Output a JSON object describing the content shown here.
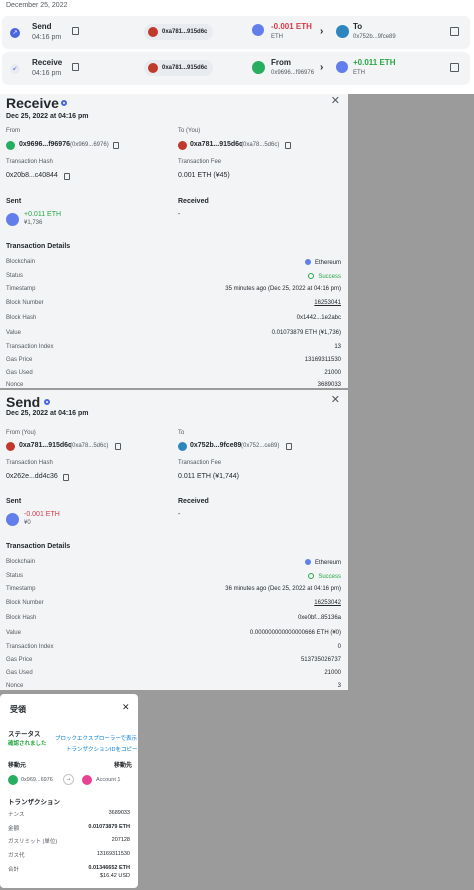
{
  "activity": {
    "date": "December 25, 2022",
    "rows": [
      {
        "type": "Send",
        "time": "04:16 pm",
        "chip": "0xa781...915d6c",
        "amount": "-0.001 ETH",
        "amount_sub": "ETH",
        "to_label": "To",
        "to_addr": "0x752b...9fce89",
        "amount_color": "#d73a49"
      },
      {
        "type": "Receive",
        "time": "04:16 pm",
        "chip": "0xa781...915d6c",
        "from_label": "From",
        "from_addr": "0x9696...f96976",
        "amount": "+0.011 ETH",
        "amount_sub": "ETH",
        "amount_color": "#28a745"
      }
    ]
  },
  "receive": {
    "title": "Receive",
    "date": "Dec 25, 2022 at 04:16 pm",
    "from_label": "From",
    "from_addr": "0x9696...f96976",
    "from_addr_paren": "(0x969...6976)",
    "to_label": "To (You)",
    "to_addr": "0xa781...915d6c",
    "to_addr_paren": "(0xa78...5d6c)",
    "tx_hash_label": "Transaction Hash",
    "tx_hash": "0x20b8...c40844",
    "fee_label": "Transaction Fee",
    "fee": "0.001 ETH (¥45)",
    "sent_label": "Sent",
    "sent_amount": "+0.011 ETH",
    "sent_fiat": "¥1,736",
    "received_label": "Received",
    "received_value": "-",
    "details_label": "Transaction Details",
    "details": [
      {
        "k": "Blockchain",
        "v": "Ethereum"
      },
      {
        "k": "Status",
        "v": "Success"
      },
      {
        "k": "Timestamp",
        "v": "35 minutes ago (Dec 25, 2022 at 04:16 pm)"
      },
      {
        "k": "Block Number",
        "v": "16253041"
      },
      {
        "k": "Block Hash",
        "v": "0x1442...1e2abc"
      },
      {
        "k": "Value",
        "v": "0.01073879 ETH (¥1,736)"
      },
      {
        "k": "Transaction Index",
        "v": "13"
      },
      {
        "k": "Gas Price",
        "v": "13169311530"
      },
      {
        "k": "Gas Used",
        "v": "21000"
      },
      {
        "k": "Nonce",
        "v": "3689033"
      }
    ]
  },
  "send": {
    "title": "Send",
    "date": "Dec 25, 2022 at 04:16 pm",
    "from_label": "From (You)",
    "from_addr": "0xa781...915d6c",
    "from_addr_paren": "(0xa78...5d6c)",
    "to_label": "To",
    "to_addr": "0x752b...9fce89",
    "to_addr_paren": "(0x752...ce89)",
    "tx_hash_label": "Transaction Hash",
    "tx_hash": "0x262e...dd4c36",
    "fee_label": "Transaction Fee",
    "fee": "0.011 ETH (¥1,744)",
    "sent_label": "Sent",
    "sent_amount": "-0.001 ETH",
    "sent_fiat": "¥0",
    "received_label": "Received",
    "received_value": "-",
    "details_label": "Transaction Details",
    "details": [
      {
        "k": "Blockchain",
        "v": "Ethereum"
      },
      {
        "k": "Status",
        "v": "Success"
      },
      {
        "k": "Timestamp",
        "v": "36 minutes ago (Dec 25, 2022 at 04:16 pm)"
      },
      {
        "k": "Block Number",
        "v": "16253042"
      },
      {
        "k": "Block Hash",
        "v": "0xe0bf...85136a"
      },
      {
        "k": "Value",
        "v": "0.000000000000000666 ETH (¥0)"
      },
      {
        "k": "Transaction Index",
        "v": "0"
      },
      {
        "k": "Gas Price",
        "v": "513735026737"
      },
      {
        "k": "Gas Used",
        "v": "21000"
      },
      {
        "k": "Nonce",
        "v": "3"
      }
    ]
  },
  "jp": {
    "title": "受領",
    "status_label": "ステータス",
    "status_value": "確認されました",
    "link_explorer": "ブロックエクスプローラーで表示",
    "link_copy": "トランザクションIDをコピー",
    "from_label": "移動元",
    "to_label": "移動先",
    "from_addr": "0x969...6976",
    "to_account": "Account 1",
    "tx_label": "トランザクション",
    "rows": [
      {
        "k": "ナンス",
        "v": "3689033"
      },
      {
        "k": "金額",
        "v": "0.01073879 ETH"
      },
      {
        "k": "ガスリミット (単位)",
        "v": "207128"
      },
      {
        "k": "ガス代",
        "v": "13169311530"
      },
      {
        "k": "合計",
        "v": "0.01346652 ETH"
      }
    ],
    "total_fiat": "$16.42 USD"
  }
}
